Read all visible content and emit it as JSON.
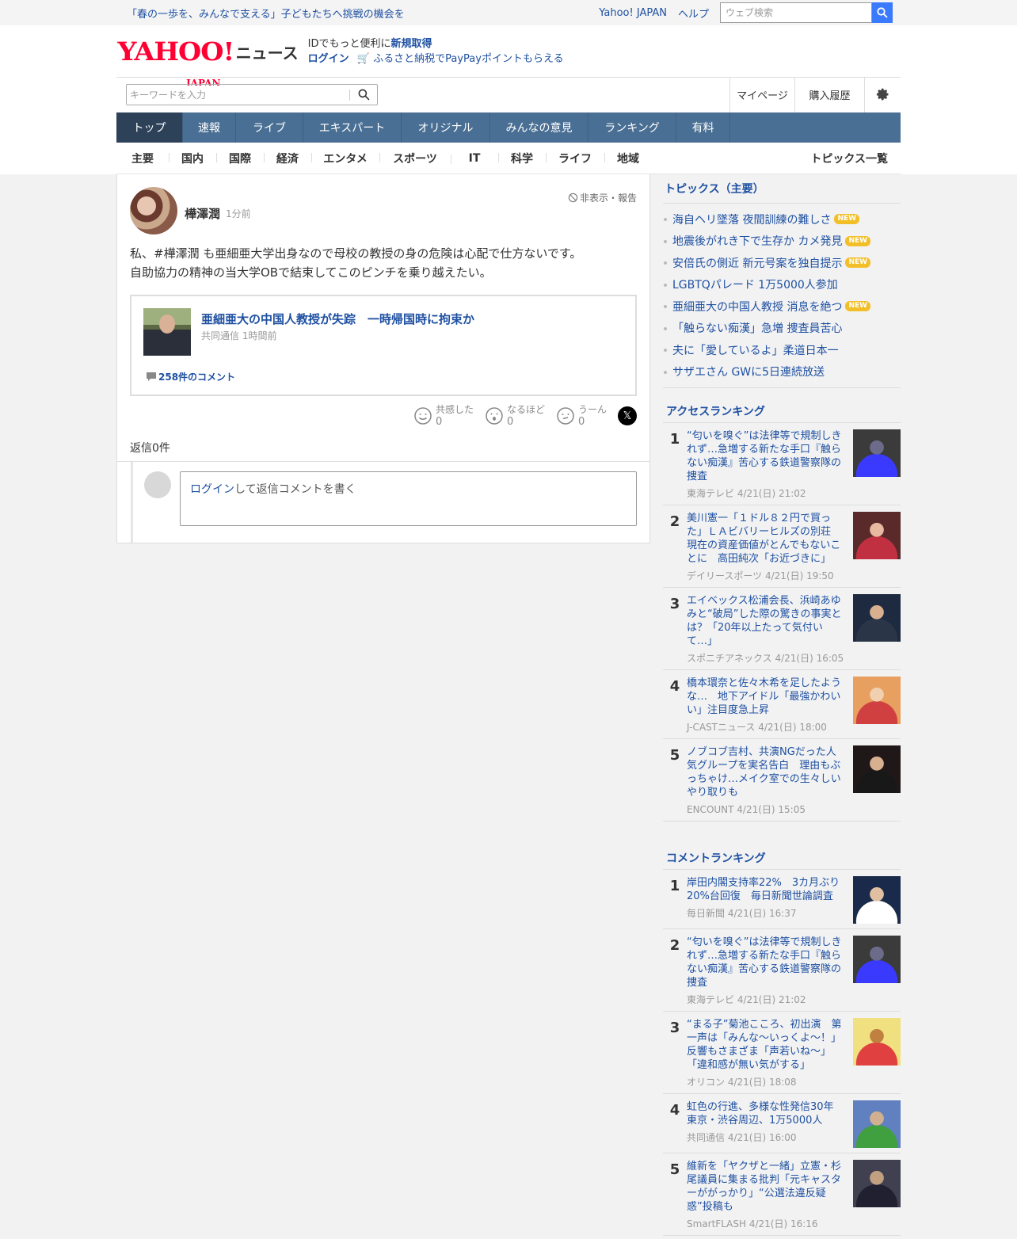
{
  "topbar": {
    "promo": "「春の一歩を、みんなで支える」子どもたちへ挑戦の機会を",
    "yahoo_japan": "Yahoo! JAPAN",
    "help": "ヘルプ",
    "web_search_placeholder": "ウェブ検索"
  },
  "header": {
    "logo_yahoo": "YAHOO!",
    "logo_japan": "JAPAN",
    "logo_news": "ニュース",
    "id_text": "IDでもっと便利に",
    "signup": "新規取得",
    "login": "ログイン",
    "furusato": "ふるさと納税でPayPayポイントもらえる"
  },
  "search": {
    "placeholder": "キーワードを入力"
  },
  "usernav": {
    "mypage": "マイページ",
    "history": "購入履歴"
  },
  "mainnav": [
    "トップ",
    "速報",
    "ライブ",
    "エキスパート",
    "オリジナル",
    "みんなの意見",
    "ランキング",
    "有料"
  ],
  "subnav": {
    "items": [
      "主要",
      "国内",
      "国際",
      "経済",
      "エンタメ",
      "スポーツ",
      "IT",
      "科学",
      "ライフ",
      "地域"
    ],
    "topics": "トピックス一覧"
  },
  "post": {
    "author": "樺澤潤",
    "time": "1分前",
    "report": "非表示・報告",
    "comment_line1": "私、#樺澤潤 も亜細亜大学出身なので母校の教授の身の危険は心配で仕方ないです。",
    "comment_line2": "自助協力の精神の当大学OBで結束してこのピンチを乗り越えたい。",
    "article_title": "亜細亜大の中国人教授が失踪　一時帰国時に拘束か",
    "article_source": "共同通信 1時間前",
    "article_comments": "258件のコメント",
    "reactions": [
      {
        "label": "共感した",
        "count": "0"
      },
      {
        "label": "なるほど",
        "count": "0"
      },
      {
        "label": "うーん",
        "count": "0"
      }
    ],
    "replies": "返信0件",
    "reply_login": "ログイン",
    "reply_placeholder": "して返信コメントを書く"
  },
  "topics": {
    "title": "トピックス（主要）",
    "new_label": "NEW",
    "items": [
      {
        "text": "海自ヘリ墜落 夜間訓練の難しさ",
        "new": true
      },
      {
        "text": "地震後がれき下で生存か カメ発見",
        "new": true
      },
      {
        "text": "安倍氏の側近 新元号案を独自提示",
        "new": true
      },
      {
        "text": "LGBTQパレード 1万5000人参加",
        "new": false
      },
      {
        "text": "亜細亜大の中国人教授 消息を絶つ",
        "new": true
      },
      {
        "text": "「触らない痴漢」急増 捜査員苦心",
        "new": false
      },
      {
        "text": "夫に「愛しているよ」柔道日本一",
        "new": false
      },
      {
        "text": "サザエさん GWに5日連続放送",
        "new": false
      }
    ]
  },
  "access_ranking": {
    "title": "アクセスランキング",
    "items": [
      {
        "rank": "1",
        "text": "“匂いを嗅ぐ”は法律等で規制しきれず…急増する新たな手口『触らない痴漢』苦心する鉄道警察隊の捜査",
        "meta": "東海テレビ 4/21(日) 21:02"
      },
      {
        "rank": "2",
        "text": "美川憲一「１ドル８２円で買った」ＬＡビバリーヒルズの別荘　現在の資産価値がとんでもないことに　高田純次「お近づきに」",
        "meta": "デイリースポーツ 4/21(日) 19:50"
      },
      {
        "rank": "3",
        "text": "エイベックス松浦会長、浜崎あゆみと“破局”した際の驚きの事実とは？「20年以上たって気付いて…」",
        "meta": "スポニチアネックス 4/21(日) 16:05"
      },
      {
        "rank": "4",
        "text": "橋本環奈と佐々木希を足したような…　地下アイドル「最強かわいい」注目度急上昇",
        "meta": "J-CASTニュース 4/21(日) 18:00"
      },
      {
        "rank": "5",
        "text": "ノブコブ吉村、共演NGだった人気グループを実名告白　理由もぶっちゃけ…メイク室での生々しいやり取りも",
        "meta": "ENCOUNT 4/21(日) 15:05"
      }
    ]
  },
  "comment_ranking": {
    "title": "コメントランキング",
    "items": [
      {
        "rank": "1",
        "text": "岸田内閣支持率22%　3カ月ぶり20%台回復　毎日新聞世論調査",
        "meta": "毎日新聞 4/21(日) 16:37"
      },
      {
        "rank": "2",
        "text": "“匂いを嗅ぐ”は法律等で規制しきれず…急増する新たな手口『触らない痴漢』苦心する鉄道警察隊の捜査",
        "meta": "東海テレビ 4/21(日) 21:02"
      },
      {
        "rank": "3",
        "text": "“まる子”菊池こころ、初出演　第一声は「みんな〜いっくよ〜！」反響もさまざま「声若いね〜」「違和感が無い気がする」",
        "meta": "オリコン 4/21(日) 18:08"
      },
      {
        "rank": "4",
        "text": "虹色の行進、多様な性発信30年　東京・渋谷周辺、1万5000人",
        "meta": "共同通信 4/21(日) 16:00"
      },
      {
        "rank": "5",
        "text": "維新を「ヤクザと一緒」立憲・杉尾議員に集まる批判「元キャスターががっかり」“公選法違反疑惑”投稿も",
        "meta": "SmartFLASH 4/21(日) 16:16"
      }
    ]
  },
  "colors": {
    "link": "#1e50a2",
    "nav_bg": "#4a6f94",
    "nav_active": "#2d4159",
    "brand": "#ff0033",
    "new_badge": "#f3bf29",
    "search_btn": "#3a7aff"
  }
}
